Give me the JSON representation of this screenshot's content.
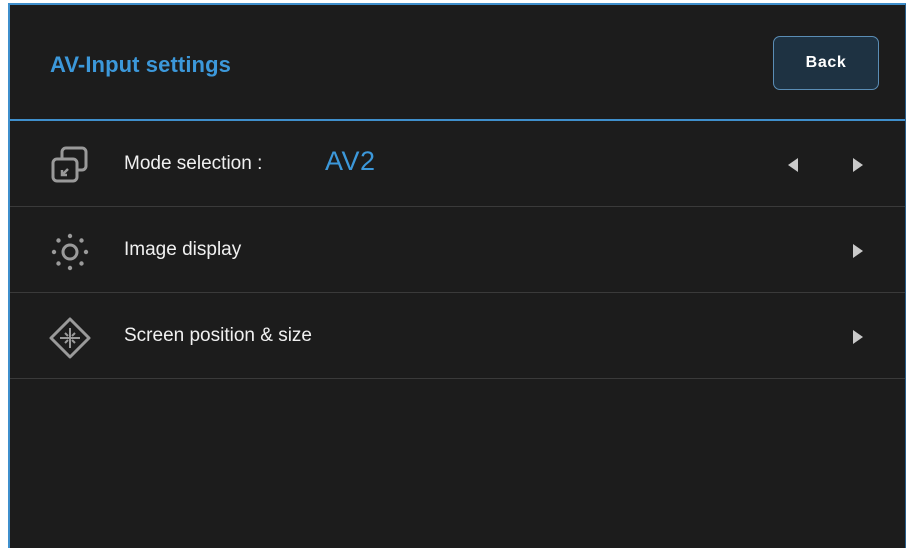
{
  "header": {
    "title": "AV-Input settings",
    "back_label": "Back"
  },
  "menu": {
    "items": [
      {
        "label": "Mode selection :",
        "value": "AV2",
        "icon": "input-source-icon",
        "arrows": [
          "left",
          "right"
        ]
      },
      {
        "label": "Image display",
        "icon": "brightness-icon",
        "arrows": [
          "right"
        ]
      },
      {
        "label": "Screen position & size",
        "icon": "move-position-icon",
        "arrows": [
          "right"
        ]
      }
    ]
  },
  "colors": {
    "accent": "#3c98da",
    "background": "#1c1c1c",
    "text": "#f0f0f0",
    "button_bg": "#1e3242"
  }
}
